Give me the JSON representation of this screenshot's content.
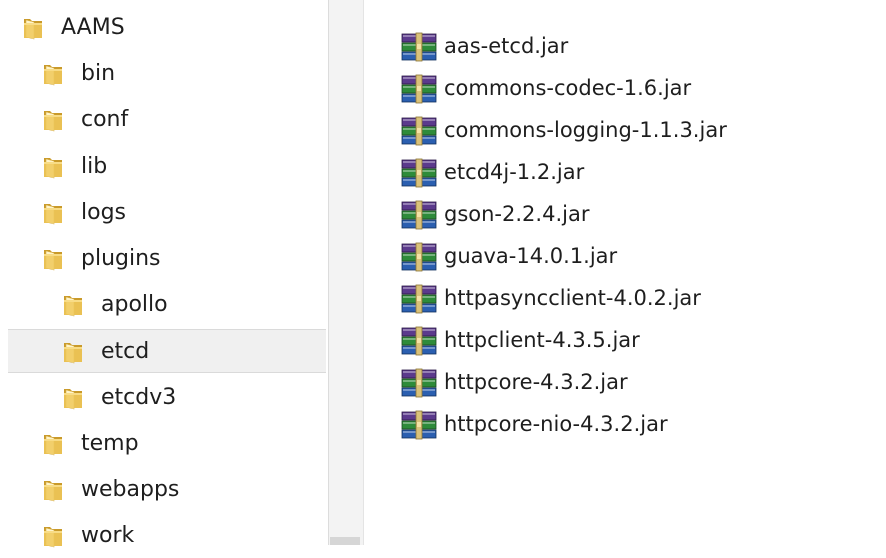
{
  "tree": {
    "items": [
      {
        "label": "AAMS",
        "level": 0,
        "selected": false
      },
      {
        "label": "bin",
        "level": 1,
        "selected": false
      },
      {
        "label": "conf",
        "level": 1,
        "selected": false
      },
      {
        "label": "lib",
        "level": 1,
        "selected": false
      },
      {
        "label": "logs",
        "level": 1,
        "selected": false
      },
      {
        "label": "plugins",
        "level": 1,
        "selected": false
      },
      {
        "label": "apollo",
        "level": 2,
        "selected": false
      },
      {
        "label": "etcd",
        "level": 2,
        "selected": true
      },
      {
        "label": "etcdv3",
        "level": 2,
        "selected": false
      },
      {
        "label": "temp",
        "level": 1,
        "selected": false
      },
      {
        "label": "webapps",
        "level": 1,
        "selected": false
      },
      {
        "label": "work",
        "level": 1,
        "selected": false
      }
    ]
  },
  "files": [
    {
      "name": "aas-etcd.jar",
      "icon": "winrar-archive-icon"
    },
    {
      "name": "commons-codec-1.6.jar",
      "icon": "winrar-archive-icon"
    },
    {
      "name": "commons-logging-1.1.3.jar",
      "icon": "winrar-archive-icon"
    },
    {
      "name": "etcd4j-1.2.jar",
      "icon": "winrar-archive-icon"
    },
    {
      "name": "gson-2.2.4.jar",
      "icon": "winrar-archive-icon"
    },
    {
      "name": "guava-14.0.1.jar",
      "icon": "winrar-archive-icon"
    },
    {
      "name": "httpasyncclient-4.0.2.jar",
      "icon": "winrar-archive-icon"
    },
    {
      "name": "httpclient-4.3.5.jar",
      "icon": "winrar-archive-icon"
    },
    {
      "name": "httpcore-4.3.2.jar",
      "icon": "winrar-archive-icon"
    },
    {
      "name": "httpcore-nio-4.3.2.jar",
      "icon": "winrar-archive-icon"
    }
  ],
  "colors": {
    "folder_front": "#f0c85a",
    "folder_back": "#c99a2a",
    "selection_bg": "#f0f0f0",
    "rar_purple": "#5b3a8c",
    "rar_green": "#2e8b3a",
    "rar_blue": "#2b5fb0"
  }
}
